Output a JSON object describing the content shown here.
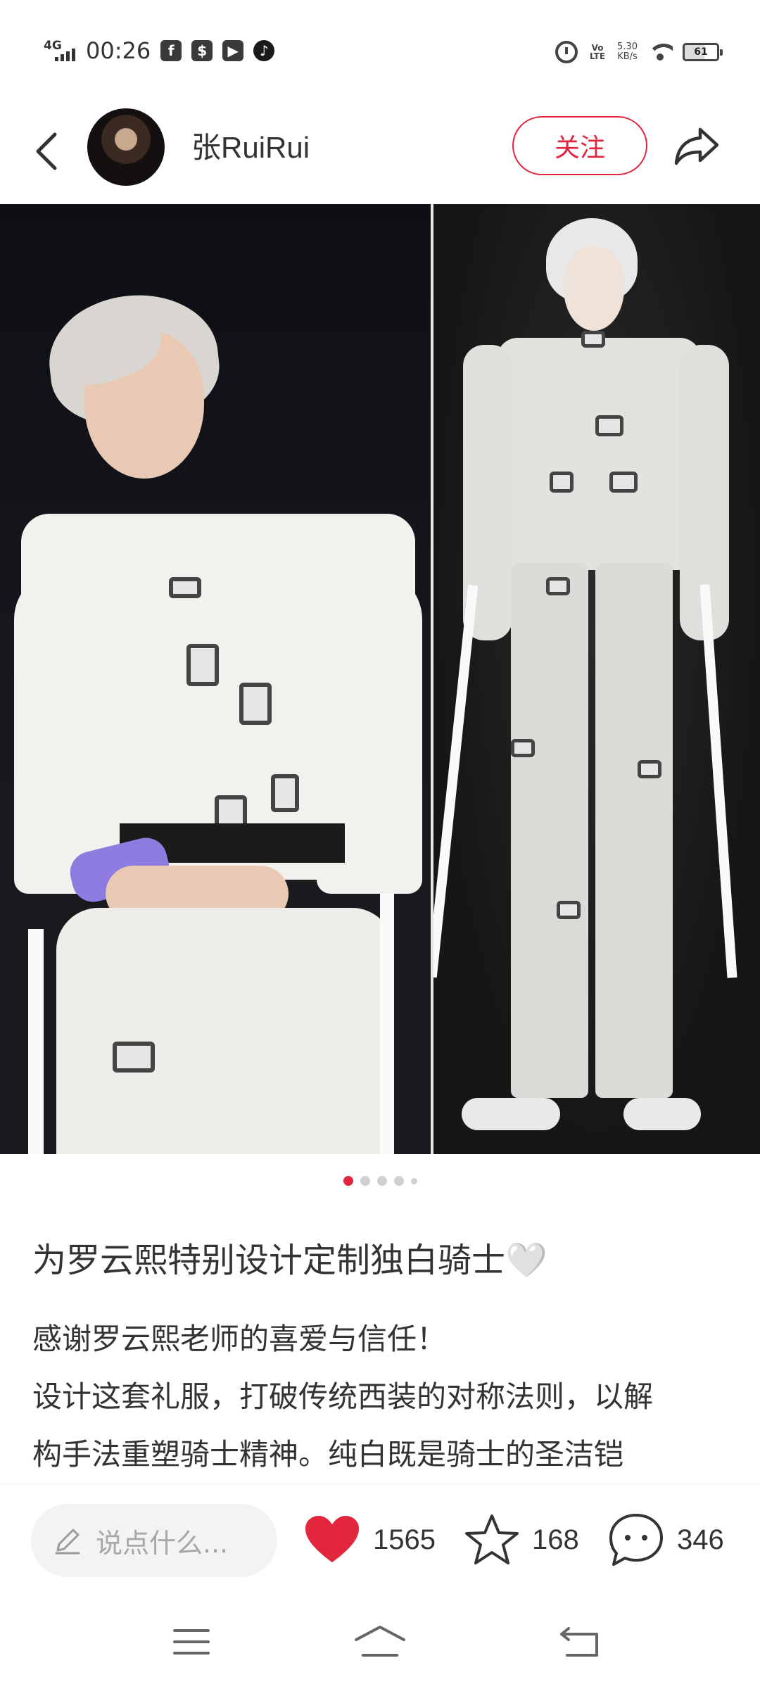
{
  "status_bar": {
    "network": "4G",
    "time": "00:26",
    "volte": "Vo LTE",
    "speed_value": "5.30",
    "speed_unit": "KB/s",
    "battery": "61"
  },
  "header": {
    "author_name": "张RuiRui",
    "follow_label": "关注"
  },
  "carousel": {
    "total": 5,
    "active_index": 0
  },
  "post": {
    "title": "为罗云熙特别设计定制独白骑士🤍",
    "body_lines": [
      "感谢罗云熙老师的喜爱与信任！",
      "设计这套礼服，打破传统西装的对称法则，以解",
      "构手法重塑骑士精神。纯白既是骑士的圣洁铠"
    ]
  },
  "actions": {
    "comment_placeholder": "说点什么...",
    "likes": "1565",
    "favorites": "168",
    "comments": "346"
  },
  "colors": {
    "accent": "#e2263d"
  }
}
